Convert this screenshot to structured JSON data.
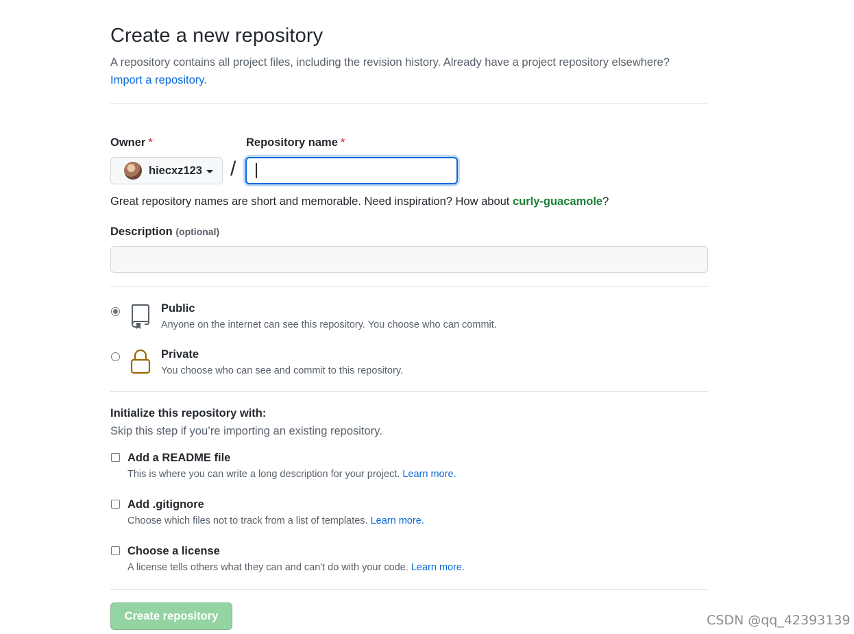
{
  "header": {
    "title": "Create a new repository",
    "subtitle": "A repository contains all project files, including the revision history. Already have a project repository elsewhere?",
    "import_link": "Import a repository."
  },
  "owner": {
    "label": "Owner",
    "required_mark": "*",
    "value": "hiecxz123"
  },
  "separator": "/",
  "repo_name": {
    "label": "Repository name",
    "required_mark": "*",
    "value": ""
  },
  "hint": {
    "text": "Great repository names are short and memorable. Need inspiration? How about ",
    "suggestion": "curly-guacamole",
    "end": "?"
  },
  "description": {
    "label": "Description",
    "optional": "(optional)",
    "value": ""
  },
  "visibility": {
    "selected": "public",
    "options": [
      {
        "title": "Public",
        "desc": "Anyone on the internet can see this repository. You choose who can commit.",
        "icon": "repo-icon"
      },
      {
        "title": "Private",
        "desc": "You choose who can see and commit to this repository.",
        "icon": "lock-icon"
      }
    ]
  },
  "initialize": {
    "title": "Initialize this repository with:",
    "desc": "Skip this step if you’re importing an existing repository.",
    "options": [
      {
        "title": "Add a README file",
        "desc": "This is where you can write a long description for your project.",
        "link": "Learn more.",
        "checked": false
      },
      {
        "title": "Add .gitignore",
        "desc": "Choose which files not to track from a list of templates.",
        "link": "Learn more.",
        "checked": false
      },
      {
        "title": "Choose a license",
        "desc": "A license tells others what they can and can't do with your code.",
        "link": "Learn more.",
        "checked": false
      }
    ]
  },
  "submit": {
    "label": "Create repository",
    "disabled": true
  },
  "watermark": "CSDN @qq_42393139",
  "colors": {
    "link": "#0969da",
    "suggestion": "#1a7f37",
    "required": "#cf222e",
    "button_disabled": "#94d3a2",
    "lock_icon": "#9a6700"
  }
}
